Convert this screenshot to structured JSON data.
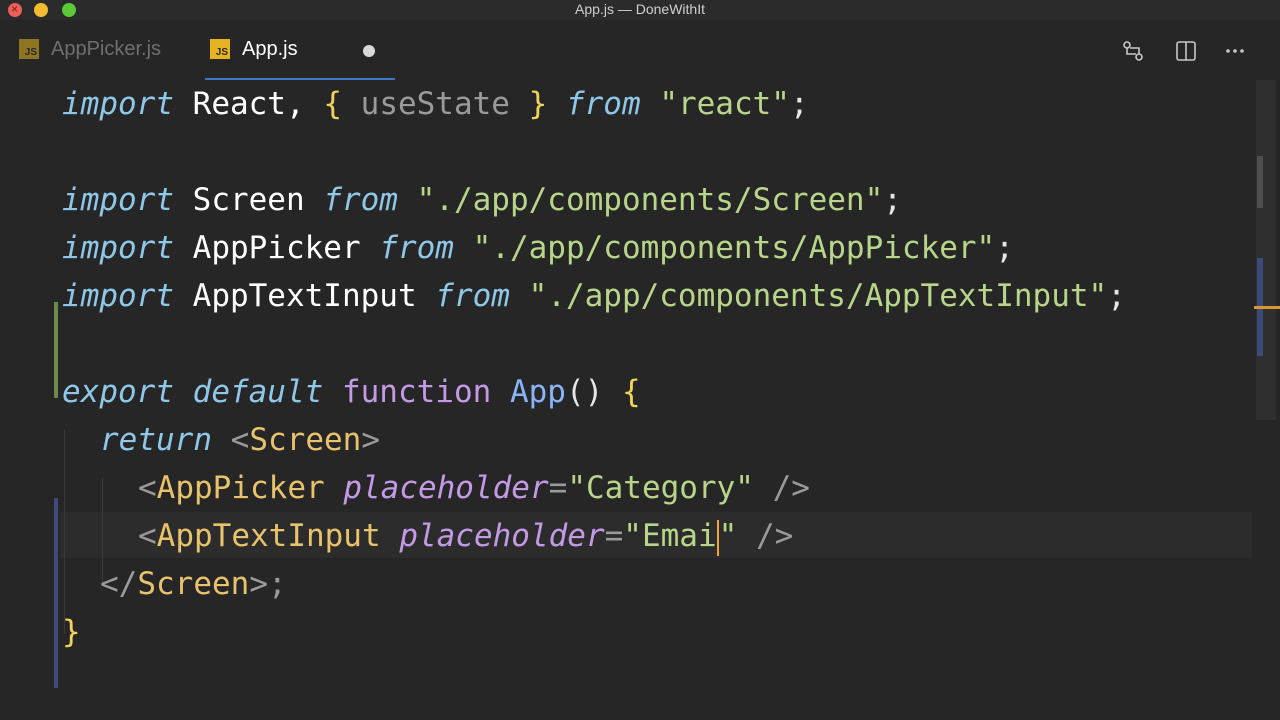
{
  "window": {
    "title": "App.js — DoneWithIt"
  },
  "tabs": [
    {
      "label": "AppPicker.js",
      "badge": "JS"
    },
    {
      "label": "App.js",
      "badge": "JS"
    }
  ],
  "code": {
    "l1": {
      "kw": "import",
      "ident": "React,",
      "brace_open": "{",
      "dim": "useState",
      "brace_close": "}",
      "from": "from",
      "str": "\"react\"",
      "end": ";"
    },
    "l3": {
      "kw": "import",
      "ident": "Screen",
      "from": "from",
      "str": "\"./app/components/Screen\"",
      "end": ";"
    },
    "l4": {
      "kw": "import",
      "ident": "AppPicker",
      "from": "from",
      "str": "\"./app/components/AppPicker\"",
      "end": ";"
    },
    "l5": {
      "kw": "import",
      "ident": "AppTextInput",
      "from": "from",
      "str": "\"./app/components/AppTextInput\"",
      "end": ";"
    },
    "l7": {
      "export": "export",
      "default": "default",
      "function": "function",
      "name": "App",
      "parens": "()",
      "brace": "{"
    },
    "l8": {
      "ret": "return",
      "lt": "<",
      "tag": "Screen",
      "gt": ">"
    },
    "l9": {
      "lt": "<",
      "tag": "AppPicker",
      "attr": "placeholder",
      "eq": "=",
      "str": "\"Category\"",
      "close": "/>"
    },
    "l10": {
      "lt": "<",
      "tag": "AppTextInput",
      "attr": "placeholder",
      "eq": "=",
      "str": "\"Emai",
      "quote": "\"",
      "close": "/>"
    },
    "l11": {
      "open": "</",
      "tag": "Screen",
      "close": ">;"
    },
    "l12": {
      "brace": "}"
    }
  }
}
